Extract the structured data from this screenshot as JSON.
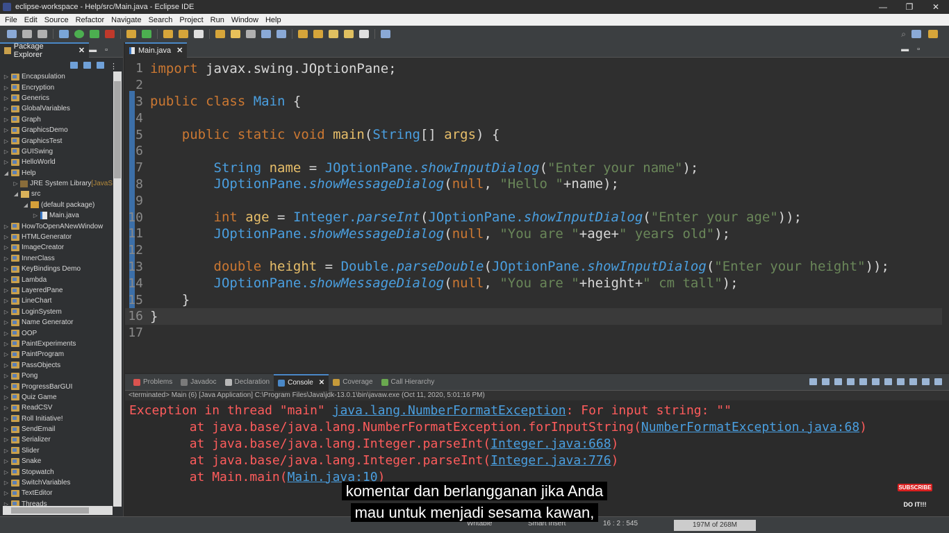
{
  "window": {
    "title": "eclipse-workspace - Help/src/Main.java - Eclipse IDE",
    "controls": [
      "—",
      "❐",
      "✕"
    ]
  },
  "menu": [
    "File",
    "Edit",
    "Source",
    "Refactor",
    "Navigate",
    "Search",
    "Project",
    "Run",
    "Window",
    "Help"
  ],
  "package_explorer": {
    "title": "Package Explorer",
    "items": [
      {
        "label": "Encapsulation",
        "depth": 0,
        "kind": "proj",
        "arrow": "▷"
      },
      {
        "label": "Encryption",
        "depth": 0,
        "kind": "proj",
        "arrow": "▷"
      },
      {
        "label": "Generics",
        "depth": 0,
        "kind": "proj",
        "arrow": "▷"
      },
      {
        "label": "GlobalVariables",
        "depth": 0,
        "kind": "proj",
        "arrow": "▷"
      },
      {
        "label": "Graph",
        "depth": 0,
        "kind": "proj",
        "arrow": "▷"
      },
      {
        "label": "GraphicsDemo",
        "depth": 0,
        "kind": "proj",
        "arrow": "▷"
      },
      {
        "label": "GraphicsTest",
        "depth": 0,
        "kind": "proj",
        "arrow": "▷"
      },
      {
        "label": "GUISwing",
        "depth": 0,
        "kind": "proj",
        "arrow": "▷"
      },
      {
        "label": "HelloWorld",
        "depth": 0,
        "kind": "proj",
        "arrow": "▷"
      },
      {
        "label": "Help",
        "depth": 0,
        "kind": "proj",
        "arrow": "◢"
      },
      {
        "label": "JRE System Library",
        "suffix": " [JavaS",
        "depth": 1,
        "kind": "lib",
        "arrow": "▷"
      },
      {
        "label": "src",
        "depth": 1,
        "kind": "src",
        "arrow": "◢"
      },
      {
        "label": "(default package)",
        "depth": 2,
        "kind": "pkg",
        "arrow": "◢"
      },
      {
        "label": "Main.java",
        "depth": 3,
        "kind": "jfile",
        "arrow": "▷"
      },
      {
        "label": "HowToOpenANewWindow",
        "depth": 0,
        "kind": "proj",
        "arrow": "▷"
      },
      {
        "label": "HTMLGenerator",
        "depth": 0,
        "kind": "proj",
        "arrow": "▷"
      },
      {
        "label": "ImageCreator",
        "depth": 0,
        "kind": "proj",
        "arrow": "▷"
      },
      {
        "label": "InnerClass",
        "depth": 0,
        "kind": "proj",
        "arrow": "▷"
      },
      {
        "label": "KeyBindings Demo",
        "depth": 0,
        "kind": "proj",
        "arrow": "▷"
      },
      {
        "label": "Lambda",
        "depth": 0,
        "kind": "proj",
        "arrow": "▷"
      },
      {
        "label": "LayeredPane",
        "depth": 0,
        "kind": "proj",
        "arrow": "▷"
      },
      {
        "label": "LineChart",
        "depth": 0,
        "kind": "proj",
        "arrow": "▷"
      },
      {
        "label": "LoginSystem",
        "depth": 0,
        "kind": "proj",
        "arrow": "▷"
      },
      {
        "label": "Name Generator",
        "depth": 0,
        "kind": "proj",
        "arrow": "▷"
      },
      {
        "label": "OOP",
        "depth": 0,
        "kind": "proj",
        "arrow": "▷"
      },
      {
        "label": "PaintExperiments",
        "depth": 0,
        "kind": "proj",
        "arrow": "▷"
      },
      {
        "label": "PaintProgram",
        "depth": 0,
        "kind": "proj",
        "arrow": "▷"
      },
      {
        "label": "PassObjects",
        "depth": 0,
        "kind": "proj",
        "arrow": "▷"
      },
      {
        "label": "Pong",
        "depth": 0,
        "kind": "proj",
        "arrow": "▷"
      },
      {
        "label": "ProgressBarGUI",
        "depth": 0,
        "kind": "proj",
        "arrow": "▷"
      },
      {
        "label": "Quiz Game",
        "depth": 0,
        "kind": "proj",
        "arrow": "▷"
      },
      {
        "label": "ReadCSV",
        "depth": 0,
        "kind": "proj",
        "arrow": "▷"
      },
      {
        "label": "Roll Initiative!",
        "depth": 0,
        "kind": "proj",
        "arrow": "▷"
      },
      {
        "label": "SendEmail",
        "depth": 0,
        "kind": "proj",
        "arrow": "▷"
      },
      {
        "label": "Serializer",
        "depth": 0,
        "kind": "proj",
        "arrow": "▷"
      },
      {
        "label": "Slider",
        "depth": 0,
        "kind": "proj",
        "arrow": "▷"
      },
      {
        "label": "Snake",
        "depth": 0,
        "kind": "proj",
        "arrow": "▷"
      },
      {
        "label": "Stopwatch",
        "depth": 0,
        "kind": "proj",
        "arrow": "▷"
      },
      {
        "label": "SwitchVariables",
        "depth": 0,
        "kind": "proj",
        "arrow": "▷"
      },
      {
        "label": "TextEditor",
        "depth": 0,
        "kind": "proj",
        "arrow": "▷"
      },
      {
        "label": "Threads",
        "depth": 0,
        "kind": "proj",
        "arrow": "▷"
      }
    ]
  },
  "editor": {
    "tab_label": "Main.java",
    "code_lines": [
      [
        {
          "t": "import ",
          "c": "kw"
        },
        {
          "t": "javax.swing.JOptionPane;",
          "c": "plain"
        }
      ],
      [],
      [
        {
          "t": "public class ",
          "c": "kw"
        },
        {
          "t": "Main ",
          "c": "ty"
        },
        {
          "t": "{",
          "c": "plain"
        }
      ],
      [],
      [
        {
          "t": "    public static void ",
          "c": "kw"
        },
        {
          "t": "main",
          "c": "fn"
        },
        {
          "t": "(",
          "c": "plain"
        },
        {
          "t": "String",
          "c": "ty"
        },
        {
          "t": "[] ",
          "c": "plain"
        },
        {
          "t": "args",
          "c": "var"
        },
        {
          "t": ") {",
          "c": "plain"
        }
      ],
      [],
      [
        {
          "t": "        String ",
          "c": "ty"
        },
        {
          "t": "name",
          "c": "var"
        },
        {
          "t": " = ",
          "c": "plain"
        },
        {
          "t": "JOptionPane.",
          "c": "ty"
        },
        {
          "t": "showInputDialog",
          "c": "mth"
        },
        {
          "t": "(",
          "c": "plain"
        },
        {
          "t": "\"Enter your name\"",
          "c": "str"
        },
        {
          "t": ");",
          "c": "plain"
        }
      ],
      [
        {
          "t": "        JOptionPane.",
          "c": "ty"
        },
        {
          "t": "showMessageDialog",
          "c": "mth"
        },
        {
          "t": "(",
          "c": "plain"
        },
        {
          "t": "null",
          "c": "kw"
        },
        {
          "t": ", ",
          "c": "plain"
        },
        {
          "t": "\"Hello \"",
          "c": "str"
        },
        {
          "t": "+name);",
          "c": "plain"
        }
      ],
      [],
      [
        {
          "t": "        int ",
          "c": "kw"
        },
        {
          "t": "age",
          "c": "var"
        },
        {
          "t": " = ",
          "c": "plain"
        },
        {
          "t": "Integer.",
          "c": "ty"
        },
        {
          "t": "parseInt",
          "c": "mth"
        },
        {
          "t": "(",
          "c": "plain"
        },
        {
          "t": "JOptionPane.",
          "c": "ty"
        },
        {
          "t": "showInputDialog",
          "c": "mth"
        },
        {
          "t": "(",
          "c": "plain"
        },
        {
          "t": "\"Enter your age\"",
          "c": "str"
        },
        {
          "t": "));",
          "c": "plain"
        }
      ],
      [
        {
          "t": "        JOptionPane.",
          "c": "ty"
        },
        {
          "t": "showMessageDialog",
          "c": "mth"
        },
        {
          "t": "(",
          "c": "plain"
        },
        {
          "t": "null",
          "c": "kw"
        },
        {
          "t": ", ",
          "c": "plain"
        },
        {
          "t": "\"You are \"",
          "c": "str"
        },
        {
          "t": "+age+",
          "c": "plain"
        },
        {
          "t": "\" years old\"",
          "c": "str"
        },
        {
          "t": ");",
          "c": "plain"
        }
      ],
      [],
      [
        {
          "t": "        double ",
          "c": "kw"
        },
        {
          "t": "height",
          "c": "var"
        },
        {
          "t": " = ",
          "c": "plain"
        },
        {
          "t": "Double.",
          "c": "ty"
        },
        {
          "t": "parseDouble",
          "c": "mth"
        },
        {
          "t": "(",
          "c": "plain"
        },
        {
          "t": "JOptionPane.",
          "c": "ty"
        },
        {
          "t": "showInputDialog",
          "c": "mth"
        },
        {
          "t": "(",
          "c": "plain"
        },
        {
          "t": "\"Enter your height\"",
          "c": "str"
        },
        {
          "t": "));",
          "c": "plain"
        }
      ],
      [
        {
          "t": "        JOptionPane.",
          "c": "ty"
        },
        {
          "t": "showMessageDialog",
          "c": "mth"
        },
        {
          "t": "(",
          "c": "plain"
        },
        {
          "t": "null",
          "c": "kw"
        },
        {
          "t": ", ",
          "c": "plain"
        },
        {
          "t": "\"You are \"",
          "c": "str"
        },
        {
          "t": "+height+",
          "c": "plain"
        },
        {
          "t": "\" cm tall\"",
          "c": "str"
        },
        {
          "t": ");",
          "c": "plain"
        }
      ],
      [
        {
          "t": "    }",
          "c": "plain"
        }
      ],
      [
        {
          "t": "}",
          "c": "plain"
        }
      ],
      []
    ]
  },
  "console": {
    "tabs": [
      {
        "label": "Problems",
        "color": "#d9534f"
      },
      {
        "label": "Javadoc",
        "color": "#7a7a7a"
      },
      {
        "label": "Declaration",
        "color": "#b8b8b8"
      },
      {
        "label": "Console",
        "color": "#4a88c7",
        "active": true
      },
      {
        "label": "Coverage",
        "color": "#c59a3a"
      },
      {
        "label": "Call Hierarchy",
        "color": "#6aa84f"
      }
    ],
    "terminated": "<terminated> Main (6) [Java Application] C:\\Program Files\\Java\\jdk-13.0.1\\bin\\javaw.exe (Oct 11, 2020, 5:01:16 PM)",
    "output": [
      [
        {
          "t": "Exception in thread \"main\" ",
          "c": ""
        },
        {
          "t": "java.lang.NumberFormatException",
          "c": "link"
        },
        {
          "t": ": For input string: \"\"",
          "c": ""
        }
      ],
      [
        {
          "t": "        at java.base/java.lang.NumberFormatException.forInputString(",
          "c": ""
        },
        {
          "t": "NumberFormatException.java:68",
          "c": "link"
        },
        {
          "t": ")",
          "c": ""
        }
      ],
      [
        {
          "t": "        at java.base/java.lang.Integer.parseInt(",
          "c": ""
        },
        {
          "t": "Integer.java:668",
          "c": "link"
        },
        {
          "t": ")",
          "c": ""
        }
      ],
      [
        {
          "t": "        at java.base/java.lang.Integer.parseInt(",
          "c": ""
        },
        {
          "t": "Integer.java:776",
          "c": "link"
        },
        {
          "t": ")",
          "c": ""
        }
      ],
      [
        {
          "t": "        at Main.main(",
          "c": ""
        },
        {
          "t": "Main.java:10",
          "c": "link"
        },
        {
          "t": ")",
          "c": ""
        }
      ]
    ]
  },
  "statusbar": {
    "writable": "Writable",
    "insert_mode": "Smart Insert",
    "position": "16 : 2 : 545",
    "heap": "197M of 268M"
  },
  "subtitles": {
    "line1": "komentar dan berlangganan jika Anda",
    "line2": "mau  untuk menjadi sesama kawan,"
  },
  "badge": {
    "subscribe": "SUBSCRIBE",
    "doit": "DO IT!!!"
  }
}
